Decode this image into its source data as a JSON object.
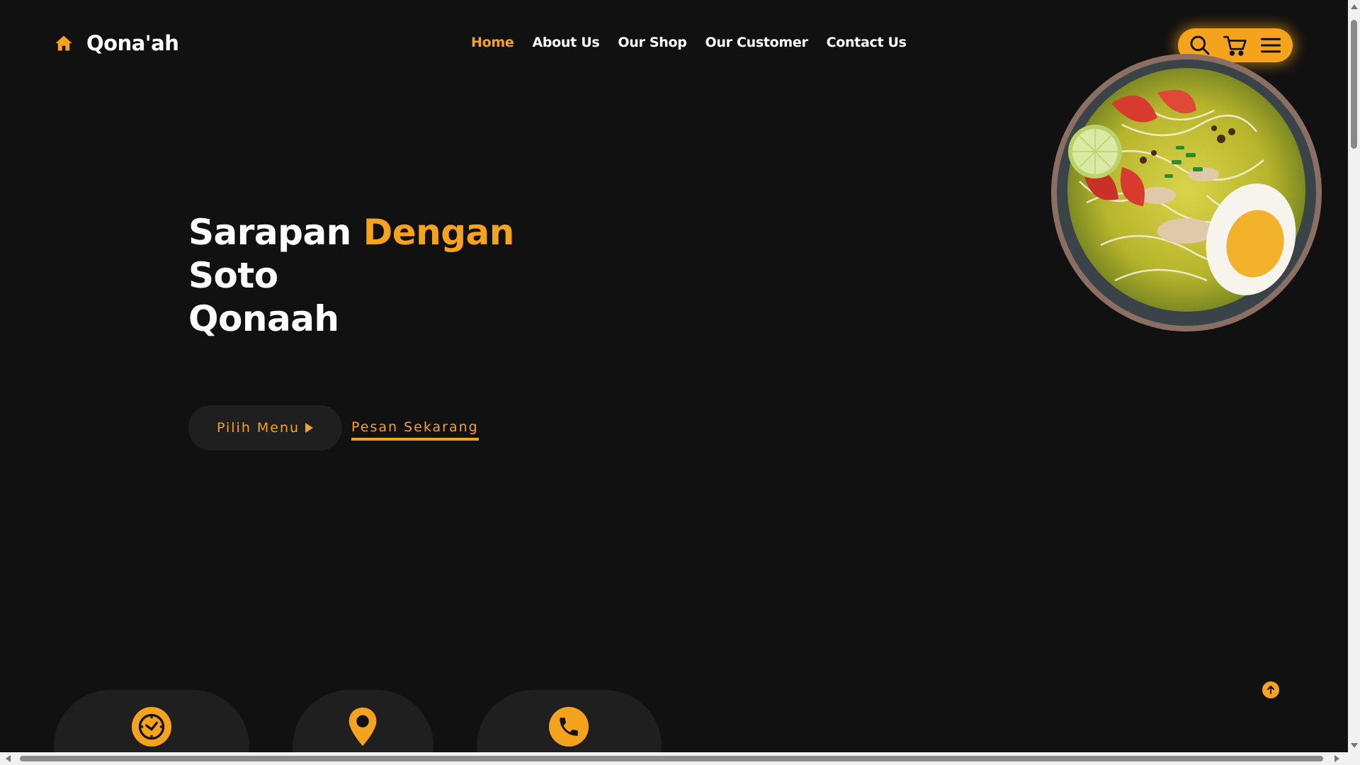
{
  "brand": {
    "name": "Qona'ah",
    "icon": "home-icon",
    "accent_color": "#f5a21c"
  },
  "nav": {
    "items": [
      {
        "label": "Home",
        "active": true
      },
      {
        "label": "About Us",
        "active": false
      },
      {
        "label": "Our Shop",
        "active": false
      },
      {
        "label": "Our Customer",
        "active": false
      },
      {
        "label": "Contact Us",
        "active": false
      }
    ]
  },
  "toolbar": {
    "icons": [
      "search-icon",
      "cart-icon",
      "menu-icon"
    ]
  },
  "hero": {
    "line1_a": "Sarapan",
    "line1_b": "Dengan",
    "line2": "Soto",
    "line3": "Qonaah",
    "primary_button": "Pilih Menu",
    "secondary_link": "Pesan Sekarang"
  },
  "cards": {
    "icons": [
      "clock-icon",
      "location-pin-icon",
      "phone-icon"
    ]
  },
  "scroll_top": {
    "icon": "arrow-up-icon"
  }
}
